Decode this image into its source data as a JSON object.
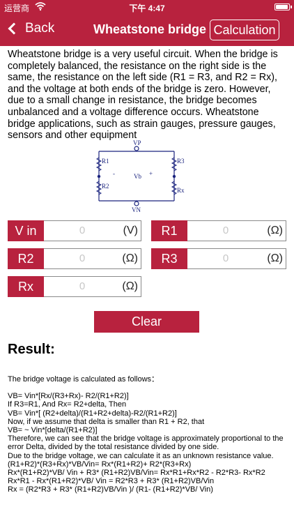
{
  "status": {
    "carrier": "运营商",
    "time": "下午 4:47"
  },
  "nav": {
    "back_label": "Back",
    "title": "Wheatstone bridge",
    "calc_label": "Calculation"
  },
  "intro": "Wheatstone bridge is a very useful circuit. When the bridge is completely balanced, the resistance on the right side is the same, the resistance on the left side (R1 = R3, and R2 = Rx), and the voltage at both ends of the bridge is zero. However, due to a small change in resistance, the bridge becomes unbalanced and a voltage difference occurs. Wheatstone bridge applications, such as strain gauges, pressure gauges, sensors and other equipment",
  "circuit": {
    "vp": "VP",
    "vn": "VN",
    "r1": "R1",
    "r2": "R2",
    "r3": "R3",
    "rx": "Rx",
    "vb": "Vb",
    "minus": "-",
    "plus": "+"
  },
  "fields": {
    "vin": {
      "label": "V in",
      "value": "0",
      "unit": "(V)"
    },
    "r1": {
      "label": "R1",
      "value": "0",
      "unit": "(Ω)"
    },
    "r2": {
      "label": "R2",
      "value": "0",
      "unit": "(Ω)"
    },
    "r3": {
      "label": "R3",
      "value": "0",
      "unit": "(Ω)"
    },
    "rx": {
      "label": "Rx",
      "value": "0",
      "unit": "(Ω)"
    }
  },
  "clear_label": "Clear",
  "result": {
    "title": "Result:",
    "lines": [
      "The bridge voltage is calculated as follows：",
      "",
      "VB=  Vin*[Rx/(R3+Rx)- R2/(R1+R2)]",
      "If R3=R1, And Rx= R2+delta, Then",
      "VB=  Vin*[ (R2+delta)/(R1+R2+delta)-R2/(R1+R2)]",
      "Now, if we assume that delta is smaller than R1 + R2,  that",
      "VB= ~ Vin*[delta/(R1+R2)]",
      "Therefore, we can see that the bridge voltage is approximately proportional to the error Delta, divided by the total resistance divided by one side.",
      "Due to the bridge voltage, we can calculate it as an unknown resistance value.",
      "(R1+R2)*(R3+Rx)*VB/Vin= Rx*(R1+R2)+ R2*(R3+Rx)",
      "Rx*(R1+R2)*VB/ Vin +  R3* (R1+R2)VB/Vin= Rx*R1+Rx*R2 - R2*R3- Rx*R2",
      "Rx*R1 - Rx*(R1+R2)*VB/ Vin  = R2*R3 + R3* (R1+R2)VB/Vin",
      "Rx = (R2*R3 + R3* (R1+R2)VB/Vin )/ (R1- (R1+R2)*VB/ Vin)"
    ]
  },
  "colors": {
    "accent": "#b8223e",
    "field_border": "#8a8a8a",
    "placeholder": "#c7c7c7"
  },
  "icons": [
    "chevron-left-icon",
    "wifi-icon",
    "battery-icon"
  ]
}
